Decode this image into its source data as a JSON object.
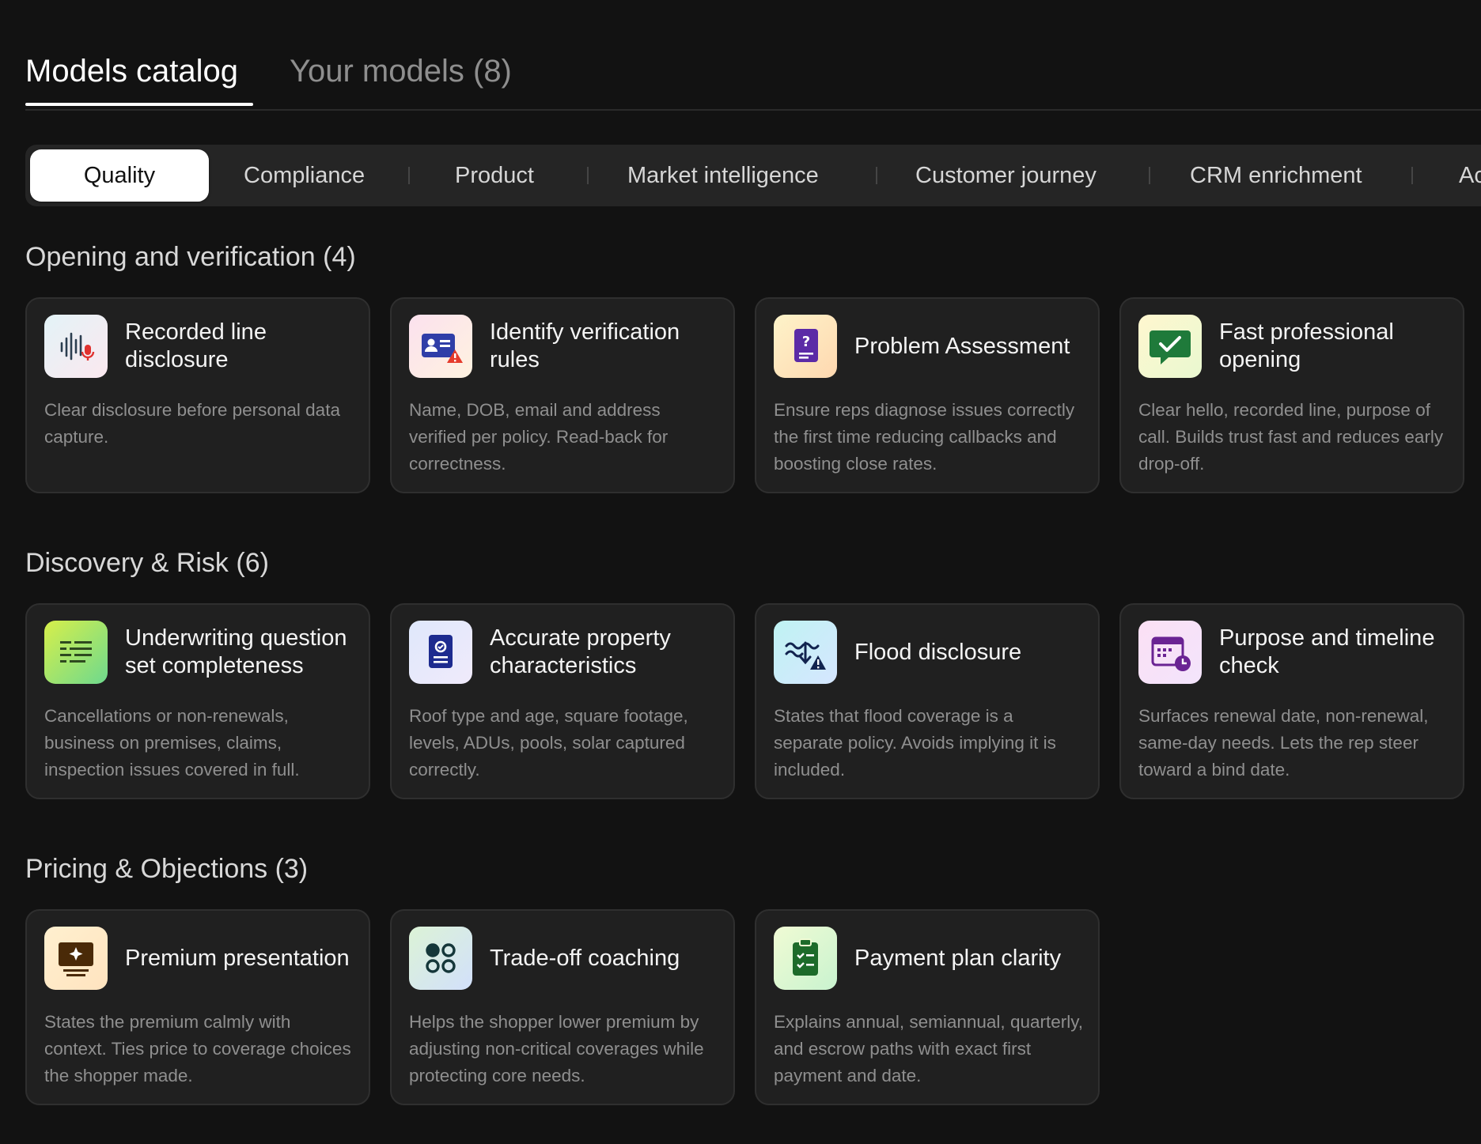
{
  "tabs": {
    "catalog": "Models catalog",
    "yours": "Your models (8)"
  },
  "categories": [
    "Quality",
    "Compliance",
    "Product",
    "Market intelligence",
    "Customer journey",
    "CRM enrichment",
    "Ac"
  ],
  "active_category": "Quality",
  "sections": [
    {
      "title": "Opening and verification (4)",
      "cards": [
        {
          "title": "Recorded line disclosure",
          "desc": "Clear disclosure before personal data capture.",
          "icon": "soundwave-mic-icon"
        },
        {
          "title": "Identify verification rules",
          "desc": "Name, DOB, email and address verified per policy. Read-back for correctness.",
          "icon": "id-card-warning-icon"
        },
        {
          "title": "Problem Assessment",
          "desc": "Ensure reps diagnose issues correctly the first time reducing callbacks and boosting close rates.",
          "icon": "question-document-icon"
        },
        {
          "title": "Fast professional opening",
          "desc": "Clear hello, recorded line, purpose of call. Builds trust fast and reduces early drop-off.",
          "icon": "check-chat-icon"
        }
      ]
    },
    {
      "title": "Discovery & Risk (6)",
      "cards": [
        {
          "title": "Underwriting question set completeness",
          "desc": "Cancellations or non-renewals, business on premises, claims, inspection issues covered in full.",
          "icon": "list-lines-icon"
        },
        {
          "title": "Accurate property characteristics",
          "desc": "Roof type and age, square footage, levels, ADUs, pools, solar captured correctly.",
          "icon": "certificate-icon"
        },
        {
          "title": "Flood disclosure",
          "desc": "States that flood coverage is a separate policy. Avoids implying it is included.",
          "icon": "flood-warning-icon"
        },
        {
          "title": "Purpose and timeline check",
          "desc": "Surfaces renewal date, non-renewal, same-day needs. Lets the rep steer toward a bind date.",
          "icon": "calendar-clock-icon"
        }
      ]
    },
    {
      "title": "Pricing & Objections (3)",
      "cards": [
        {
          "title": "Premium presentation",
          "desc": "States the premium calmly with context. Ties price to coverage choices the shopper made.",
          "icon": "presentation-sparkle-icon"
        },
        {
          "title": "Trade-off coaching",
          "desc": "Helps the shopper lower premium by adjusting non-critical coverages while protecting core needs.",
          "icon": "four-circles-icon"
        },
        {
          "title": "Payment plan clarity",
          "desc": "Explains annual, semiannual, quarterly, and escrow paths with exact first payment and date.",
          "icon": "clipboard-check-icon"
        }
      ]
    }
  ]
}
